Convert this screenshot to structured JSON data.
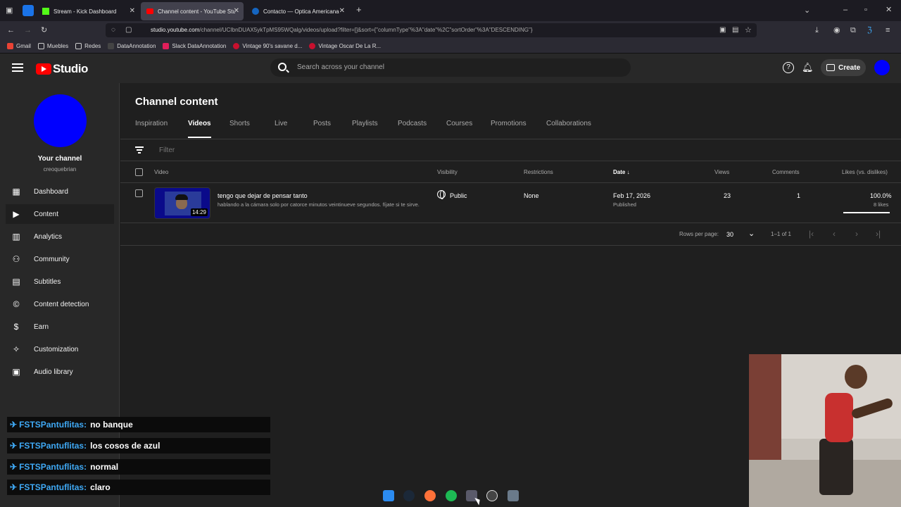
{
  "browser": {
    "tabs": [
      {
        "title": "Stream - Kick Dashboard",
        "active": false
      },
      {
        "title": "Channel content - YouTube Stu",
        "active": true
      },
      {
        "title": "Contacto — Optica Americana",
        "active": false
      }
    ],
    "url_host": "studio.youtube.com",
    "url_path": "/channel/UCIbnDUAX5ykTpMS95WQalg/videos/upload?filter=[]&sort={\"columnType\"%3A\"date\"%2C\"sortOrder\"%3A\"DESCENDING\"}",
    "bookmarks": [
      "Gmail",
      "Muebles",
      "Redes",
      "DataAnnotation",
      "Slack DataAnnotation",
      "Vintage 90's savane d...",
      "Vintage Oscar De La R..."
    ]
  },
  "header": {
    "logo_text": "Studio",
    "search_placeholder": "Search across your channel",
    "create_label": "Create"
  },
  "sidebar": {
    "channel_label": "Your channel",
    "handle": "creoquebrian",
    "items": [
      {
        "label": "Dashboard",
        "icon": "dashboard-icon",
        "active": false
      },
      {
        "label": "Content",
        "icon": "content-icon",
        "active": true
      },
      {
        "label": "Analytics",
        "icon": "analytics-icon",
        "active": false
      },
      {
        "label": "Community",
        "icon": "community-icon",
        "active": false
      },
      {
        "label": "Subtitles",
        "icon": "subtitles-icon",
        "active": false
      },
      {
        "label": "Content detection",
        "icon": "copyright-icon",
        "active": false
      },
      {
        "label": "Earn",
        "icon": "dollar-icon",
        "active": false
      },
      {
        "label": "Customization",
        "icon": "wand-icon",
        "active": false
      },
      {
        "label": "Audio library",
        "icon": "audio-icon",
        "active": false
      }
    ]
  },
  "main": {
    "title": "Channel content",
    "tabs": [
      "Inspiration",
      "Videos",
      "Shorts",
      "Live",
      "Posts",
      "Playlists",
      "Podcasts",
      "Courses",
      "Promotions",
      "Collaborations"
    ],
    "active_tab": "Videos",
    "filter_placeholder": "Filter",
    "columns": {
      "video": "Video",
      "visibility": "Visibility",
      "restrictions": "Restrictions",
      "date": "Date",
      "views": "Views",
      "comments": "Comments",
      "likes": "Likes (vs. dislikes)"
    },
    "rows": [
      {
        "title": "tengo que dejar de pensar tanto",
        "description": "hablando a la cámara solo por catorce minutos veintinueve segundos. fíjate si te sirve.",
        "duration": "14:29",
        "visibility": "Public",
        "restrictions": "None",
        "date": "Feb 17, 2026",
        "date_status": "Published",
        "views": "23",
        "comments": "1",
        "likes_pct": "100.0%",
        "likes_count": "8 likes",
        "likes_ratio": 1.0
      }
    ],
    "pagination": {
      "rows_label": "Rows per page:",
      "rows_value": "30",
      "range": "1–1 of 1"
    }
  },
  "chat": [
    {
      "user": "FSTSPantuflitas:",
      "message": "no banque"
    },
    {
      "user": "FSTSPantuflitas:",
      "message": "los cosos de azul"
    },
    {
      "user": "FSTSPantuflitas:",
      "message": "normal"
    },
    {
      "user": "FSTSPantuflitas:",
      "message": "claro"
    }
  ],
  "colors": {
    "accent_blue": "#0000ff",
    "chat_user": "#3fa9f5",
    "youtube_red": "#ff0000"
  }
}
